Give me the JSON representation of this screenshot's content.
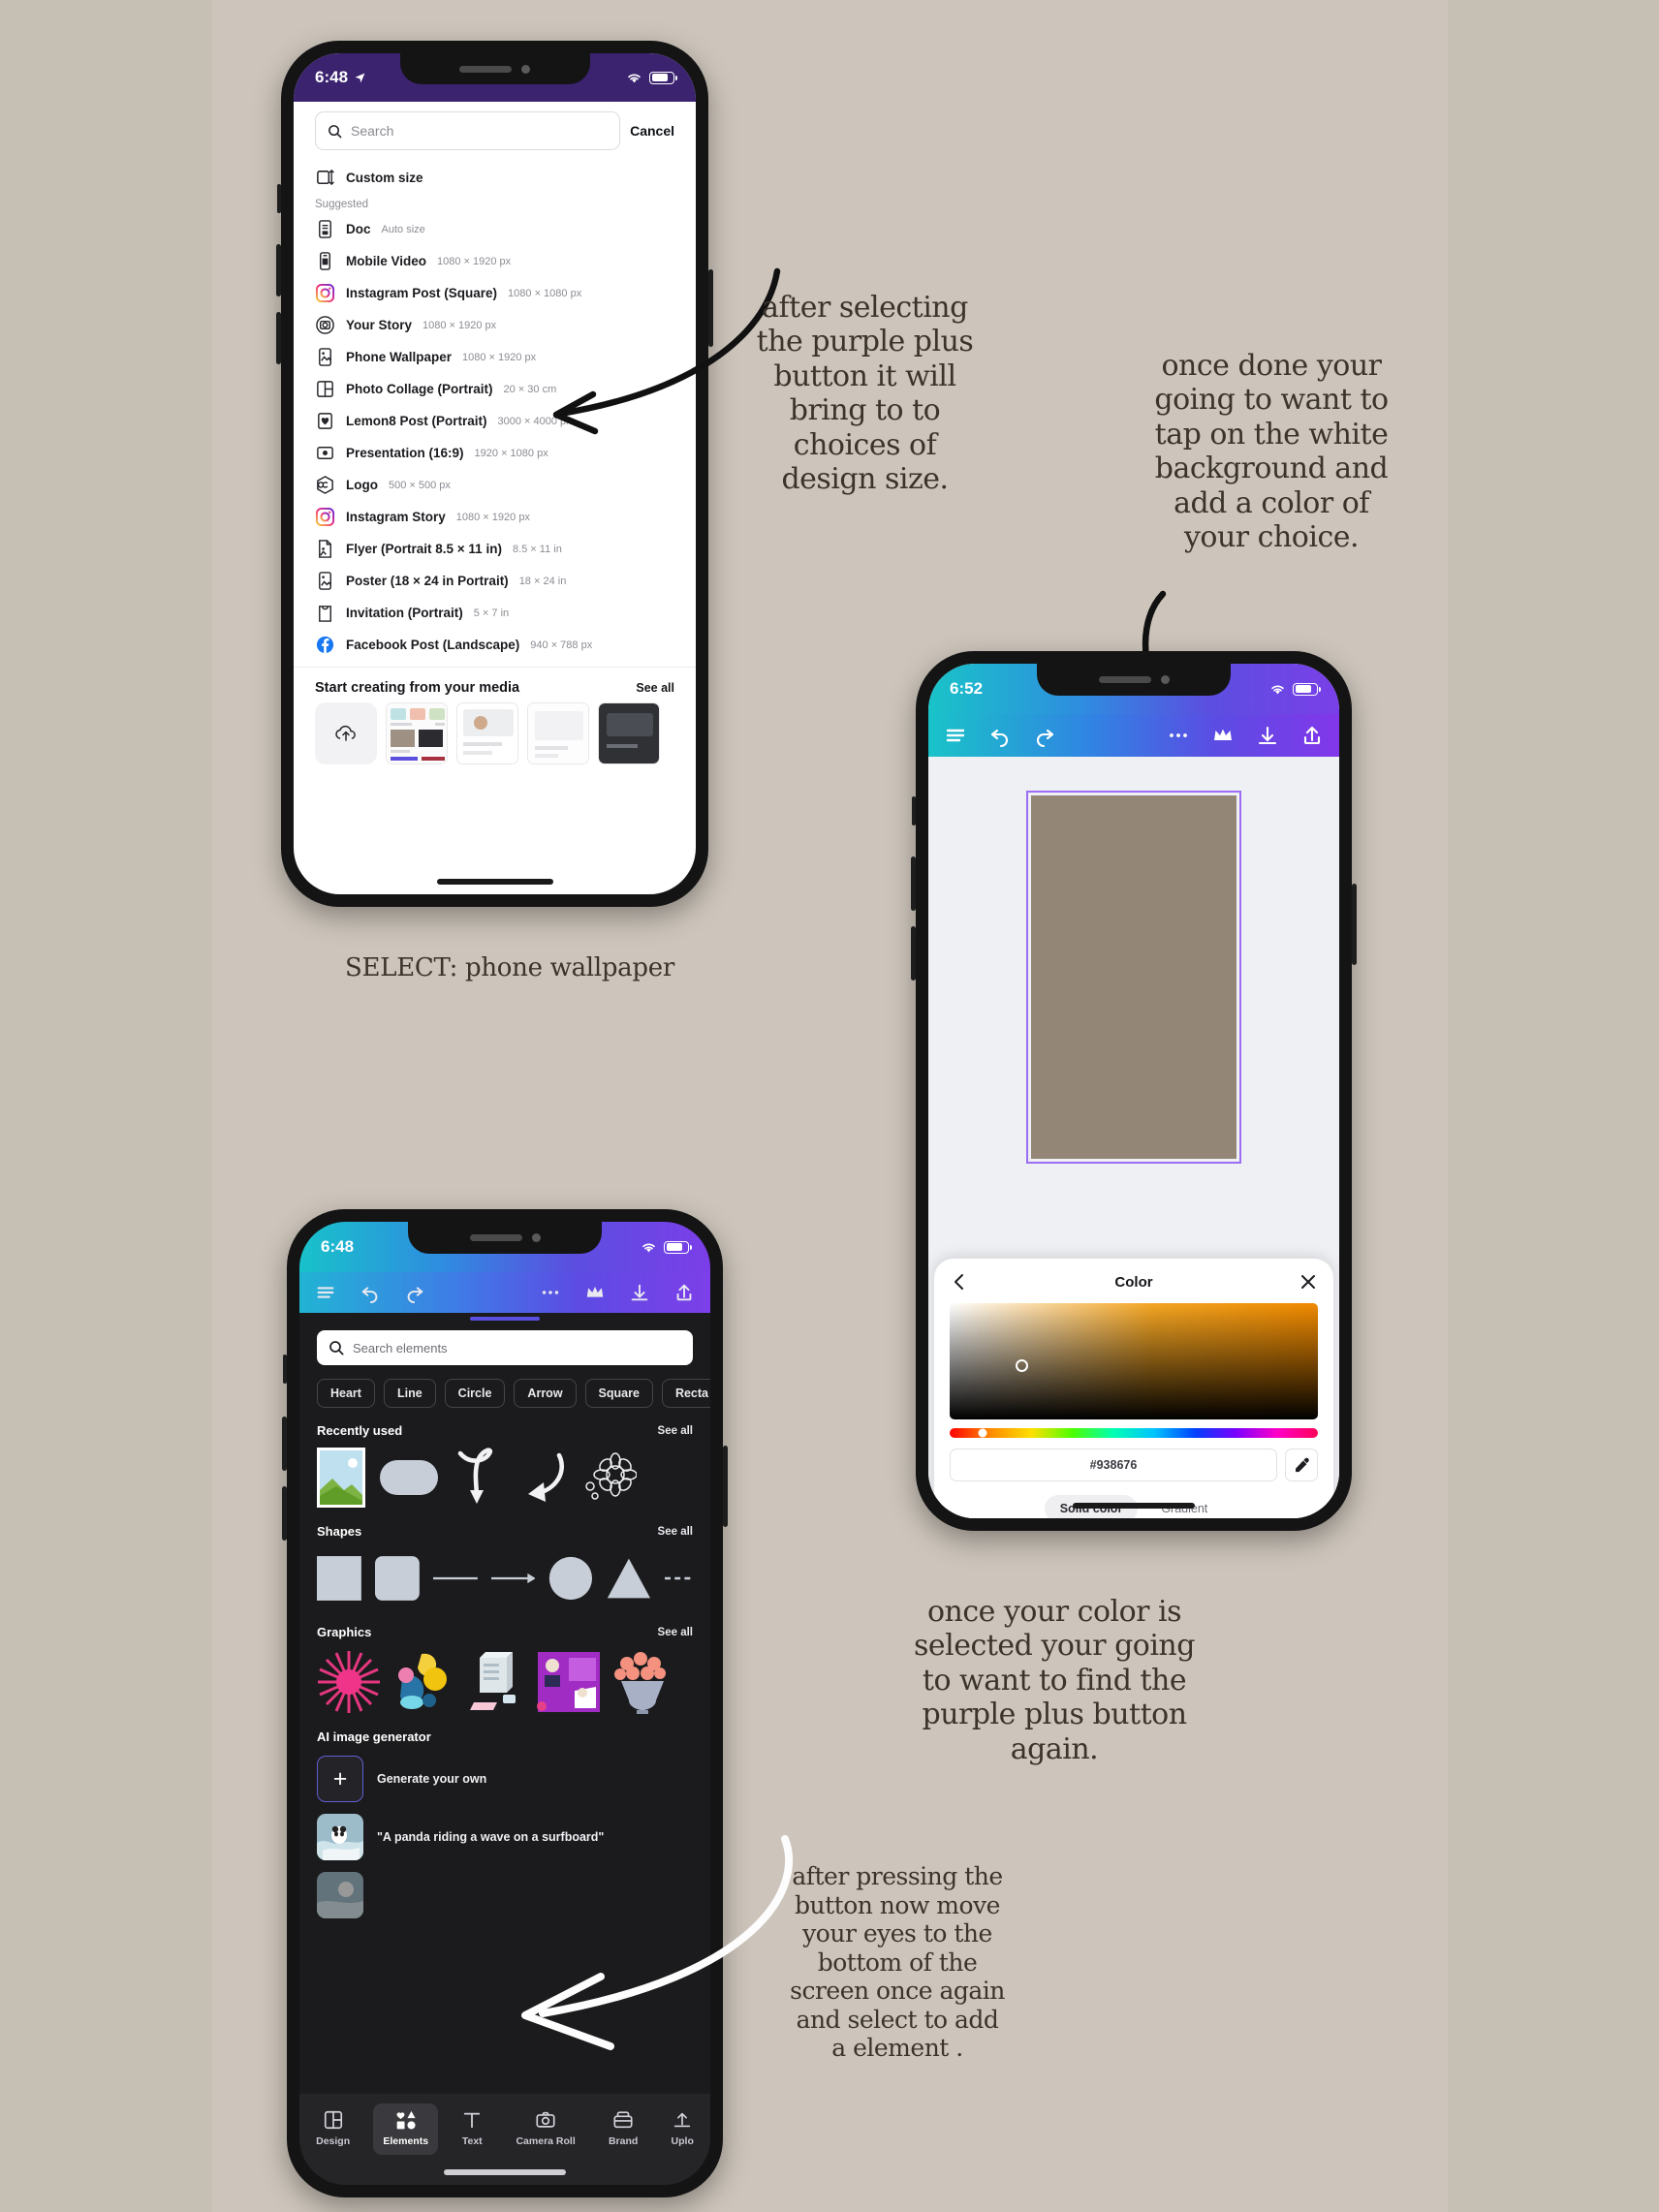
{
  "page": {
    "background_color": "#cdc5bb",
    "outer_color": "#c6bfb4"
  },
  "annotations": [
    {
      "id": "a1",
      "text": "after selecting the purple plus button it will bring to to choices of design size."
    },
    {
      "id": "a2",
      "text": "once done your going to want to tap on the white background and add a color of your choice."
    },
    {
      "id": "a3",
      "text": "once your color is selected your going to want to find the purple plus button again."
    },
    {
      "id": "a4",
      "text": "after pressing the button  now move your eyes to the bottom of the screen once again and select to add a element ."
    }
  ],
  "caption": {
    "select_label": "SELECT:",
    "select_value": "phone wallpaper"
  },
  "phone1": {
    "status": {
      "time": "6:48",
      "location_arrow": "➤"
    },
    "search": {
      "placeholder": "Search",
      "cancel_label": "Cancel"
    },
    "custom_size_label": "Custom size",
    "suggested_label": "Suggested",
    "items": [
      {
        "name": "Doc",
        "dim": "Auto size",
        "icon": "doc-icon"
      },
      {
        "name": "Mobile Video",
        "dim": "1080 × 1920 px",
        "icon": "mobile-video-icon"
      },
      {
        "name": "Instagram Post (Square)",
        "dim": "1080 × 1080 px",
        "icon": "instagram-icon"
      },
      {
        "name": "Your Story",
        "dim": "1080 × 1920 px",
        "icon": "story-icon"
      },
      {
        "name": "Phone Wallpaper",
        "dim": "1080 × 1920 px",
        "icon": "wallpaper-icon"
      },
      {
        "name": "Photo Collage (Portrait)",
        "dim": "20 × 30 cm",
        "icon": "collage-icon"
      },
      {
        "name": "Lemon8 Post (Portrait)",
        "dim": "3000 × 4000 px",
        "icon": "lemon8-icon"
      },
      {
        "name": "Presentation (16:9)",
        "dim": "1920 × 1080 px",
        "icon": "presentation-icon"
      },
      {
        "name": "Logo",
        "dim": "500 × 500 px",
        "icon": "logo-icon"
      },
      {
        "name": "Instagram Story",
        "dim": "1080 × 1920 px",
        "icon": "instagram-icon"
      },
      {
        "name": "Flyer (Portrait 8.5 × 11 in)",
        "dim": "8.5 × 11 in",
        "icon": "flyer-icon"
      },
      {
        "name": "Poster (18 × 24 in Portrait)",
        "dim": "18 × 24 in",
        "icon": "poster-icon"
      },
      {
        "name": "Invitation (Portrait)",
        "dim": "5 × 7 in",
        "icon": "invitation-icon"
      },
      {
        "name": "Facebook Post (Landscape)",
        "dim": "940 × 788 px",
        "icon": "facebook-icon"
      }
    ],
    "media": {
      "title": "Start creating from your media",
      "see_all": "See all"
    }
  },
  "phone2": {
    "status": {
      "time": "6:52"
    },
    "toolbar": [
      "menu-icon",
      "undo-icon",
      "redo-icon",
      "more-icon",
      "crown-icon",
      "download-icon",
      "share-icon"
    ],
    "artboard_color": "#938676",
    "selection_color": "#9b6ef3",
    "panel": {
      "title": "Color",
      "back_icon": "chevron-left-icon",
      "close_icon": "close-icon",
      "hex_value": "#938676",
      "eyedropper_icon": "eyedropper-icon",
      "modes": [
        {
          "label": "Solid color",
          "active": true
        },
        {
          "label": "Gradient",
          "active": false
        }
      ]
    }
  },
  "phone3": {
    "status": {
      "time": "6:48"
    },
    "toolbar": [
      "menu-icon",
      "undo-icon",
      "redo-icon",
      "more-icon",
      "crown-icon",
      "download-icon",
      "share-icon"
    ],
    "search": {
      "placeholder": "Search elements"
    },
    "chips": [
      "Heart",
      "Line",
      "Circle",
      "Arrow",
      "Square",
      "Recta"
    ],
    "sections": [
      {
        "title": "Recently used",
        "see_all": "See all"
      },
      {
        "title": "Shapes",
        "see_all": "See all"
      },
      {
        "title": "Graphics",
        "see_all": "See all"
      }
    ],
    "ai": {
      "title": "AI image generator",
      "generate_label": "Generate your own",
      "prompt": "\"A panda riding a wave on a surfboard\""
    },
    "tabs": [
      {
        "label": "Design",
        "icon": "design-icon",
        "active": false
      },
      {
        "label": "Elements",
        "icon": "elements-icon",
        "active": true
      },
      {
        "label": "Text",
        "icon": "text-icon",
        "active": false
      },
      {
        "label": "Camera Roll",
        "icon": "camera-icon",
        "active": false
      },
      {
        "label": "Brand",
        "icon": "brand-icon",
        "active": false
      },
      {
        "label": "Uplo",
        "icon": "upload-icon",
        "active": false
      }
    ]
  }
}
